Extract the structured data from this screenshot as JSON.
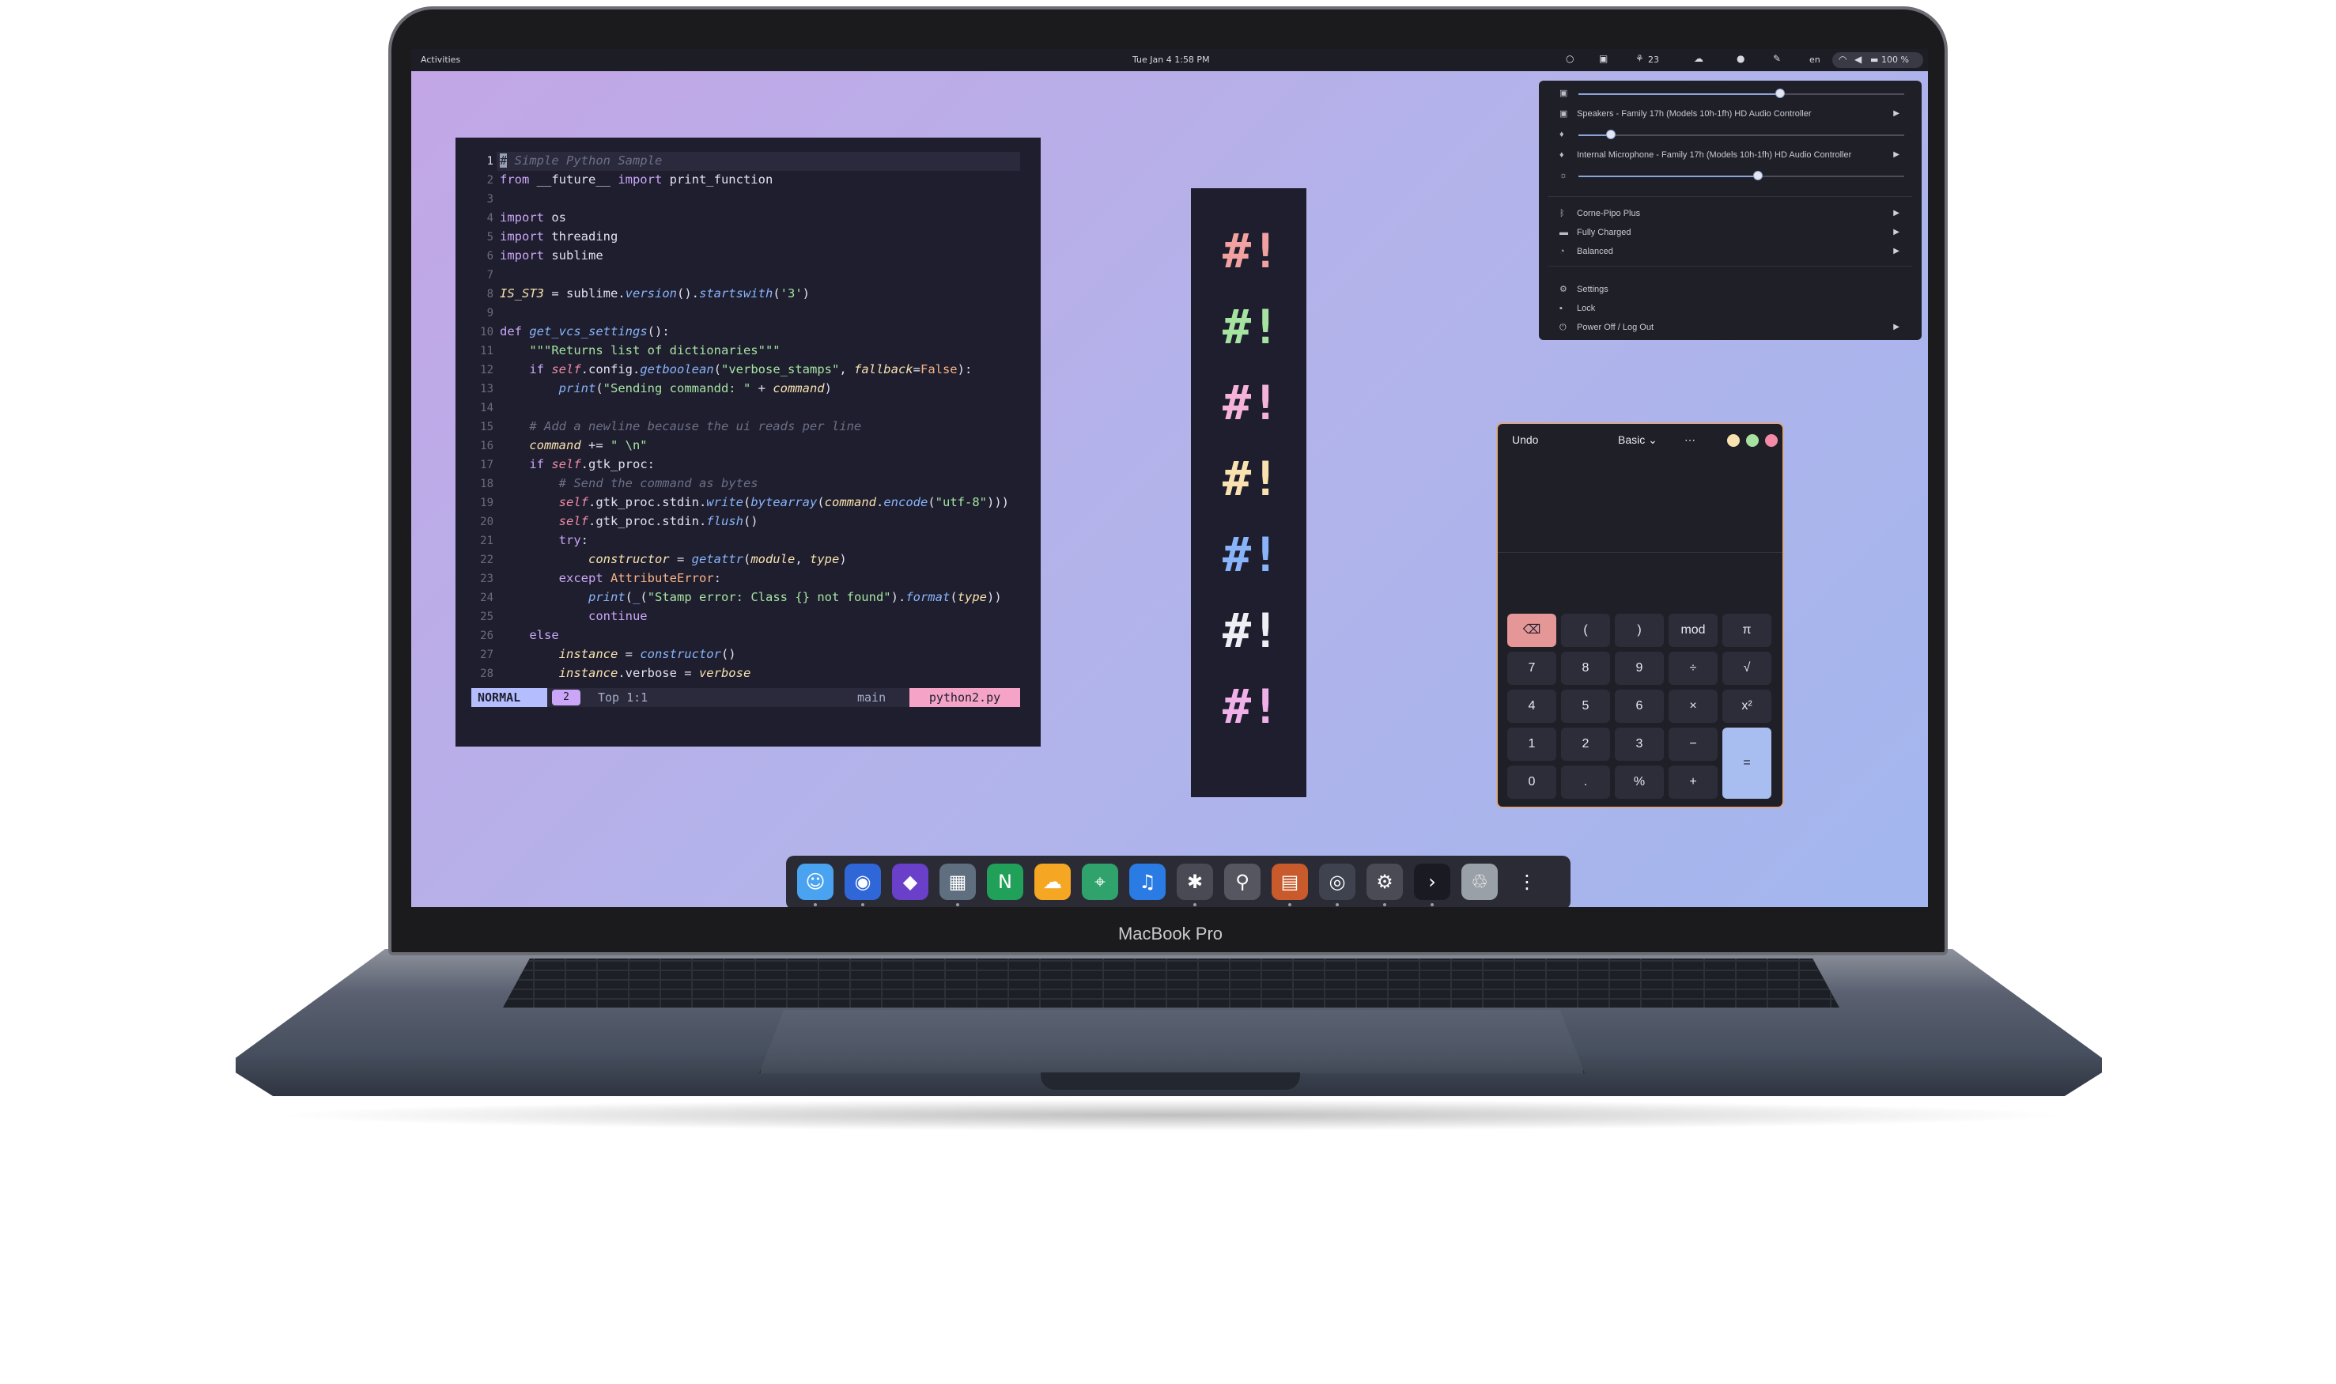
{
  "device": {
    "brand_label": "MacBook Pro"
  },
  "topbar": {
    "activities": "Activities",
    "clock": "Tue Jan 4  1:58 PM",
    "indicator_count": "23",
    "keyboard_layout": "en",
    "battery": "100 %"
  },
  "quick_settings": {
    "speaker_volume": 0.62,
    "speaker_device": "Speakers - Family 17h (Models 10h-1fh) HD Audio Controller",
    "mic_volume": 0.1,
    "mic_device": "Internal Microphone - Family 17h (Models 10h-1fh) HD Audio Controller",
    "brightness": 0.55,
    "bluetooth": "Corne-Pipo Plus",
    "battery_state": "Fully Charged",
    "power_mode": "Balanced",
    "settings": "Settings",
    "lock": "Lock",
    "power": "Power Off / Log Out",
    "icons": [
      "speaker-icon",
      "microphone-icon",
      "brightness-icon",
      "bluetooth-icon",
      "battery-icon",
      "power-mode-icon",
      "gear-icon",
      "lock-icon",
      "power-icon"
    ]
  },
  "editor": {
    "line_numbers": [
      "1",
      "2",
      "3",
      "4",
      "5",
      "6",
      "7",
      "8",
      "9",
      "10",
      "11",
      "12",
      "13",
      "14",
      "15",
      "16",
      "17",
      "18",
      "19",
      "20",
      "21",
      "22",
      "23",
      "24",
      "25",
      "26",
      "27",
      "28"
    ],
    "status": {
      "mode": "NORMAL",
      "diagnostics": "2",
      "position": "Top   1:1",
      "branch": "main",
      "file": "python2.py"
    }
  },
  "hashbang": {
    "glyph": "#!",
    "colors": [
      "#f2a0a0",
      "#a6e3a1",
      "#f5b3d8",
      "#f9e2af",
      "#89b4fa",
      "#eeeef4",
      "#f0b0e8"
    ]
  },
  "calculator": {
    "undo": "Undo",
    "mode": "Basic",
    "menu": "⋯",
    "keys": [
      [
        "⌫",
        "(",
        ")",
        "mod",
        "π"
      ],
      [
        "7",
        "8",
        "9",
        "÷",
        "√"
      ],
      [
        "4",
        "5",
        "6",
        "×",
        "x²"
      ],
      [
        "1",
        "2",
        "3",
        "−",
        "="
      ],
      [
        "0",
        ".",
        "%",
        "+",
        ""
      ]
    ]
  },
  "dock": {
    "apps": [
      "finder-icon",
      "firefox-icon",
      "obsidian-icon",
      "software-icon",
      "notes-icon",
      "weather-icon",
      "maps-icon",
      "music-icon",
      "extensions-icon",
      "usb-icon",
      "calculator-icon",
      "system-monitor-icon",
      "settings-icon",
      "terminal-icon",
      "trash-icon",
      "app-grid-icon"
    ]
  }
}
